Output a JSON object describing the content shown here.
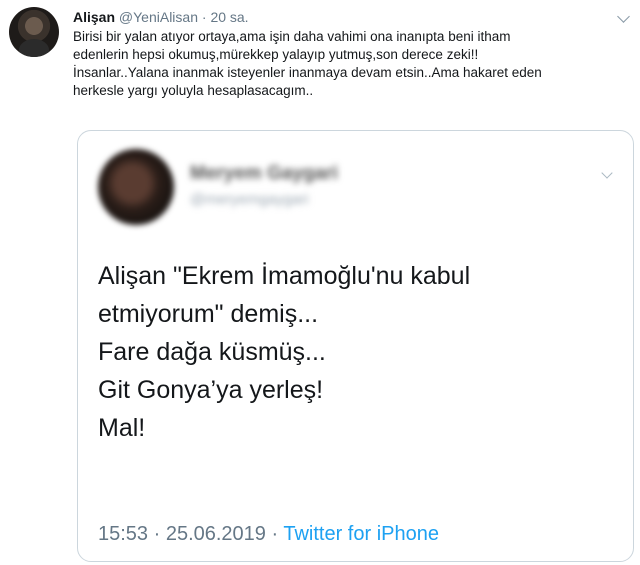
{
  "tweet": {
    "author_name": "Alişan",
    "handle": "@YeniAlisan",
    "separator": "·",
    "time": "20 sa.",
    "lines": [
      "Birisi bir yalan atıyor ortaya,ama işin daha vahimi ona inanıpta beni itham",
      "edenlerin hepsi okumuş,mürekkep yalayıp yutmuş,son derece zeki!!",
      "İnsanlar..Yalana inanmak isteyenler inanmaya devam etsin..Ama hakaret eden",
      "herkesle yargı yoluyla hesaplasacagım.."
    ]
  },
  "quoted": {
    "name": "Meryem Gaygari",
    "handle": "@meryemgaygari",
    "lines": [
      "Alişan \"Ekrem İmamoğlu'nu kabul",
      "etmiyorum\" demiş...",
      "Fare dağa küsmüş...",
      "Git Gonya’ya yerleş!",
      "Mal!"
    ],
    "timestamp": "15:53 · 25.06.2019 ·",
    "source": "Twitter for iPhone"
  },
  "colors": {
    "link": "#1da1f2",
    "muted": "#657786",
    "text": "#14171a",
    "border": "#ccd6dd"
  },
  "icons": {
    "author_menu": "chevron-down-icon",
    "quoted_menu": "chevron-down-icon"
  }
}
